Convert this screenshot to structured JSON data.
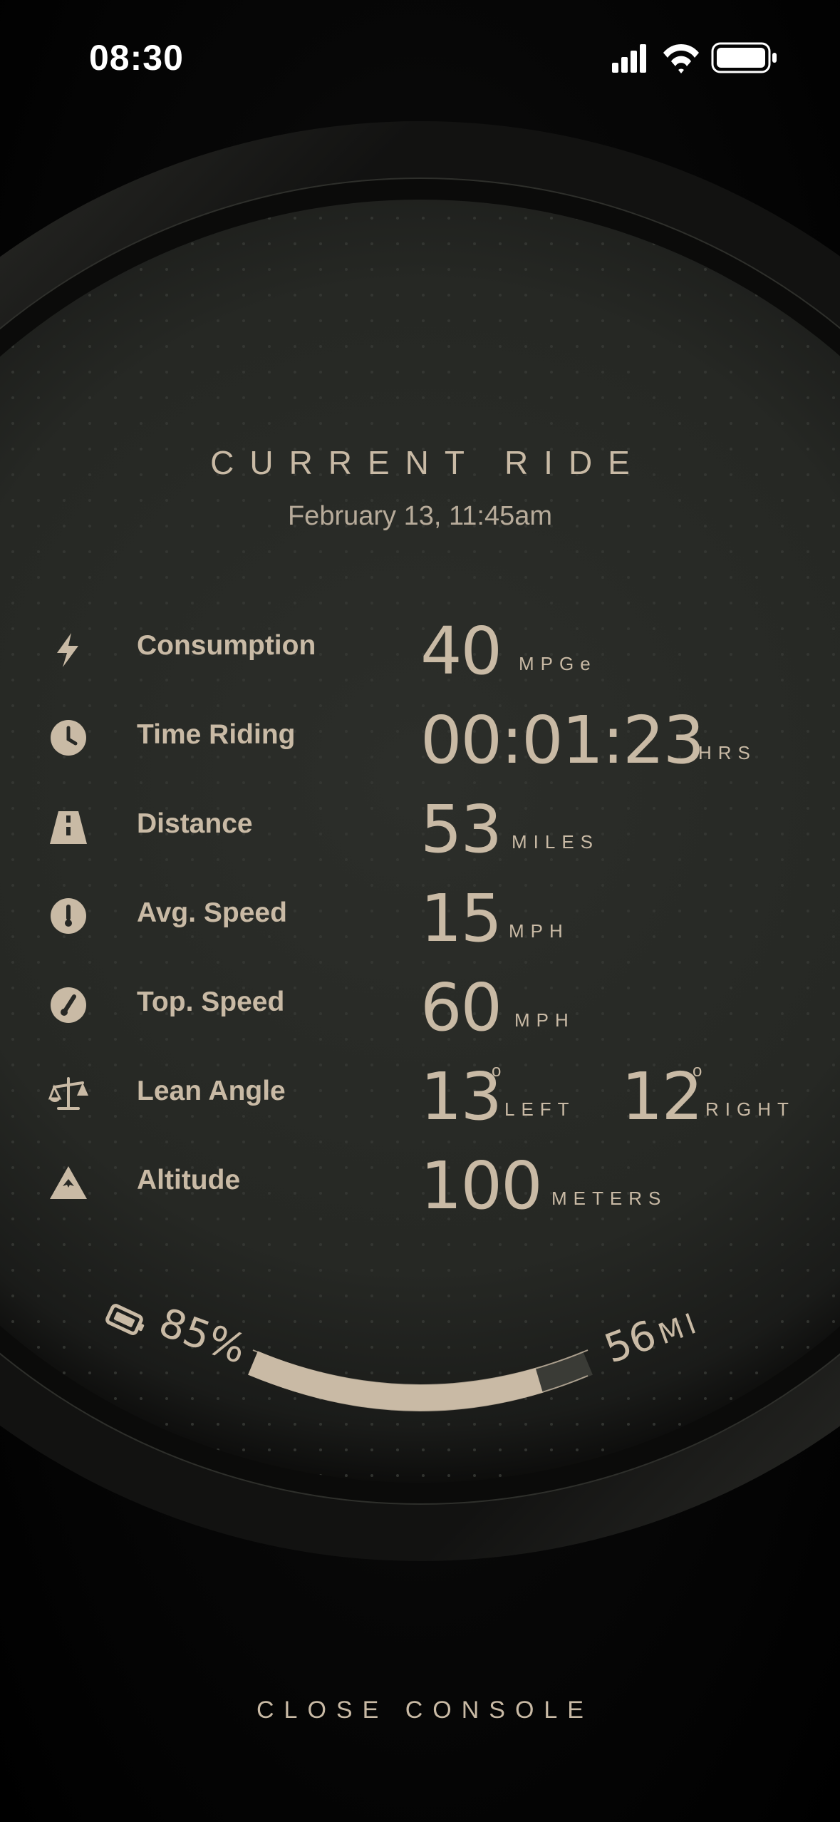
{
  "status_bar": {
    "time": "08:30"
  },
  "header": {
    "title": "CURRENT RIDE",
    "date": "February 13, 11:45am"
  },
  "stats": [
    {
      "icon": "bolt-icon",
      "label": "Consumption",
      "value": "40",
      "unit": "MPGe"
    },
    {
      "icon": "clock-icon",
      "label": "Time Riding",
      "value": "00:01:23",
      "unit": "HRS"
    },
    {
      "icon": "road-icon",
      "label": "Distance",
      "value": "53",
      "unit": "MILES"
    },
    {
      "icon": "thermometer-icon",
      "label": "Avg. Speed",
      "value": "15",
      "unit": "MPH"
    },
    {
      "icon": "speedometer-icon",
      "label": "Top. Speed",
      "value": "60",
      "unit": "MPH"
    },
    {
      "icon": "balance-scale-icon",
      "label": "Lean Angle",
      "value_left": "13",
      "unit_left": "LEFT",
      "value_right": "12",
      "unit_right": "RIGHT",
      "degree": "o"
    },
    {
      "icon": "mountain-icon",
      "label": "Altitude",
      "value": "100",
      "unit": "METERS"
    }
  ],
  "battery": {
    "percent_label": "85%",
    "fraction": 0.85,
    "range_value": "56",
    "range_unit": "MI"
  },
  "footer": {
    "close_label": "CLOSE CONSOLE"
  },
  "colors": {
    "accent": "#c9baa5",
    "background": "#000000",
    "dial": "#272825"
  }
}
